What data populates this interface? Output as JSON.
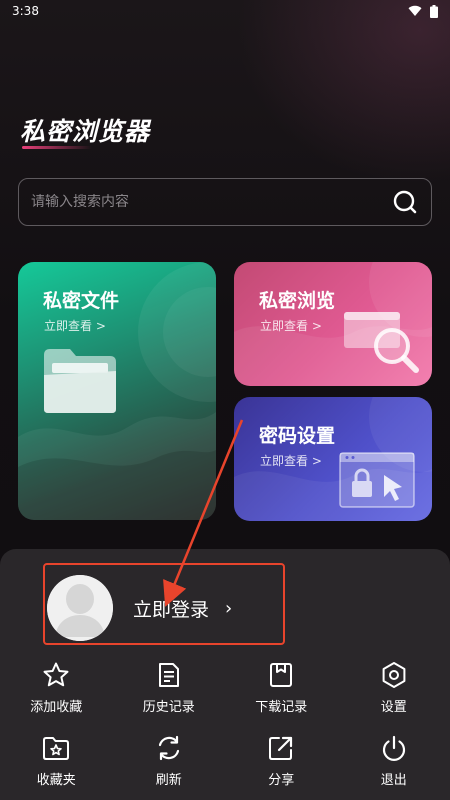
{
  "status_bar": {
    "time": "3:38"
  },
  "app": {
    "title": "私密浏览器"
  },
  "search": {
    "placeholder": "请输入搜索内容"
  },
  "cards": {
    "files": {
      "title": "私密文件",
      "subtitle": "立即查看 >"
    },
    "browse": {
      "title": "私密浏览",
      "subtitle": "立即查看 >"
    },
    "password": {
      "title": "密码设置",
      "subtitle": "立即查看 >"
    }
  },
  "login": {
    "label": "立即登录",
    "chevron": "›"
  },
  "menu": {
    "items": [
      {
        "label": "添加收藏",
        "icon": "star-icon"
      },
      {
        "label": "历史记录",
        "icon": "history-icon"
      },
      {
        "label": "下载记录",
        "icon": "download-icon"
      },
      {
        "label": "设置",
        "icon": "gear-icon"
      },
      {
        "label": "收藏夹",
        "icon": "favorites-folder-icon"
      },
      {
        "label": "刷新",
        "icon": "refresh-icon"
      },
      {
        "label": "分享",
        "icon": "share-icon"
      },
      {
        "label": "退出",
        "icon": "power-icon"
      }
    ]
  },
  "colors": {
    "background": "#120f12",
    "files_card": "#15c999",
    "browse_card": "#e05a92",
    "password_card": "#4f50c9",
    "sheet": "#2a272a",
    "annotation": "#e8442c"
  }
}
